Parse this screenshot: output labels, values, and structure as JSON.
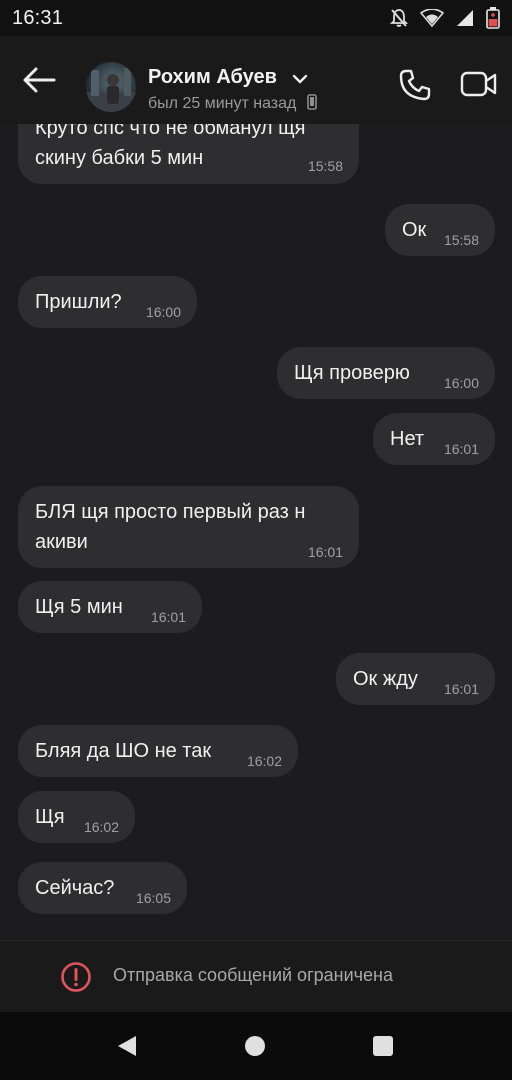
{
  "status_bar": {
    "time": "16:31"
  },
  "header": {
    "contact_name": "Рохим Абуев",
    "last_seen": "был 25 минут назад"
  },
  "messages": [
    {
      "side": "in",
      "text": "Круто спс что не обманул щя\nскину бабки 5 мин",
      "time": "15:58"
    },
    {
      "side": "out",
      "text": "Ок",
      "time": "15:58"
    },
    {
      "side": "in",
      "text": "Пришли?",
      "time": "16:00"
    },
    {
      "side": "out",
      "text": "Щя проверю",
      "time": "16:00"
    },
    {
      "side": "out",
      "text": "Нет",
      "time": "16:01"
    },
    {
      "side": "in",
      "text": "БЛЯ щя просто первый раз н\nакиви",
      "time": "16:01"
    },
    {
      "side": "in",
      "text": "Щя 5 мин",
      "time": "16:01"
    },
    {
      "side": "out",
      "text": "Ок жду",
      "time": "16:01"
    },
    {
      "side": "in",
      "text": "Бляя да ШО не так",
      "time": "16:02"
    },
    {
      "side": "in",
      "text": "Щя",
      "time": "16:02"
    },
    {
      "side": "in",
      "text": "Сейчас?",
      "time": "16:05"
    }
  ],
  "restriction_notice": {
    "text": "Отправка сообщений ограничена",
    "icon": "warning-circle-icon",
    "color": "#e0555a"
  },
  "colors": {
    "background": "#1c1c1e",
    "bubble": "#2e2e30",
    "text": "#f0f0f0",
    "timestamp": "#a0a0a3"
  }
}
